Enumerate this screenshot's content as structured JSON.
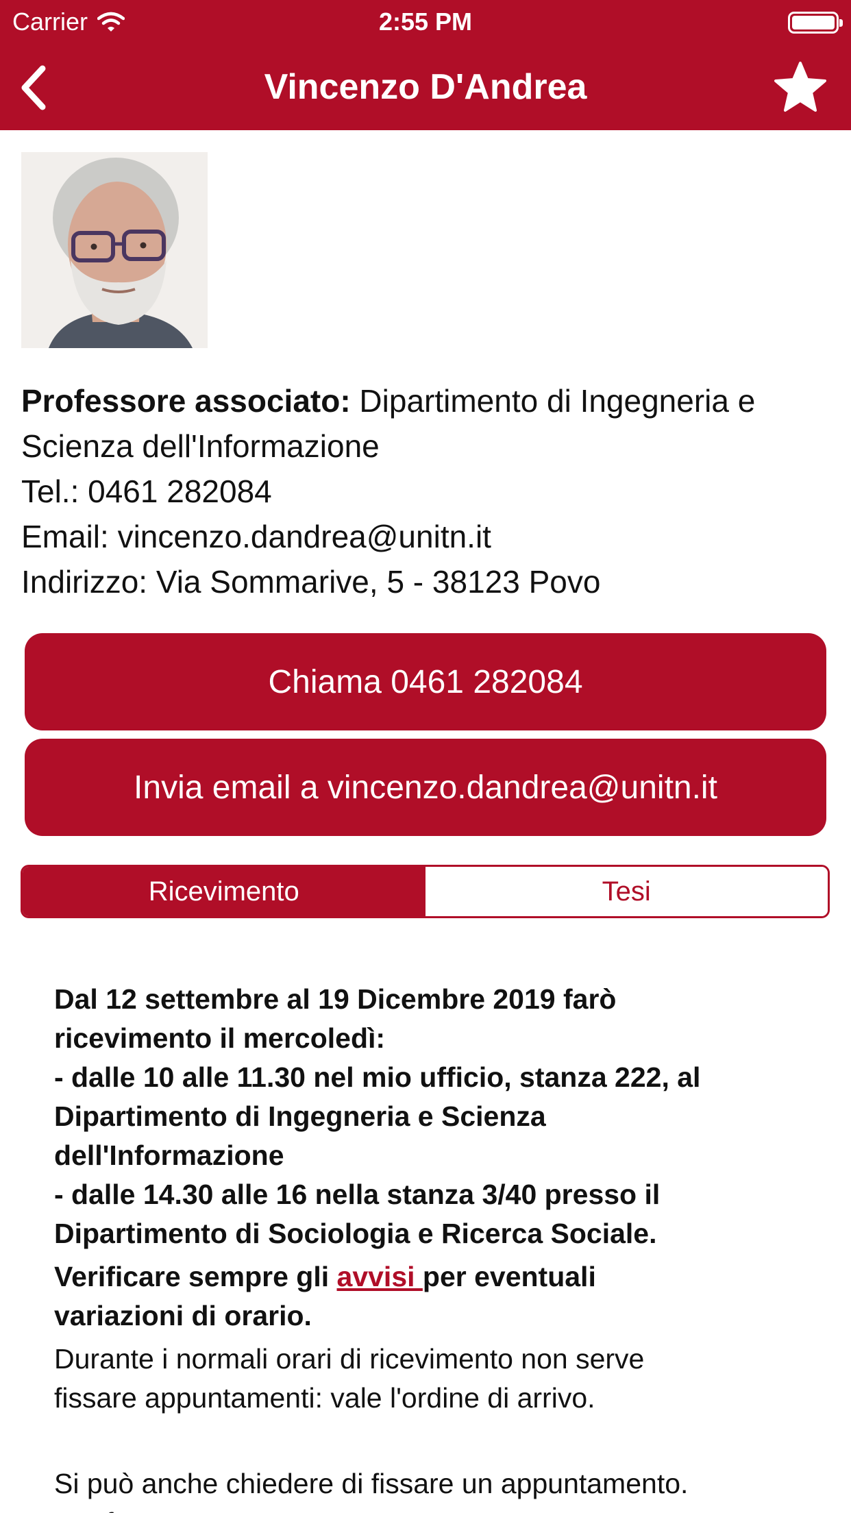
{
  "status_bar": {
    "carrier": "Carrier",
    "time": "2:55 PM"
  },
  "nav": {
    "title": "Vincenzo D'Andrea",
    "back_icon": "chevron-left-icon",
    "favorite_icon": "star-icon"
  },
  "profile": {
    "role_label": "Professore associato:",
    "department": " Dipartimento di Ingegneria e Scienza dell'Informazione",
    "phone_line": "Tel.: 0461 282084",
    "email_line": "Email: vincenzo.dandrea@unitn.it",
    "address_line": "Indirizzo: Via Sommarive, 5 - 38123 Povo"
  },
  "actions": {
    "call_label": "Chiama 0461 282084",
    "email_label": "Invia email a vincenzo.dandrea@unitn.it"
  },
  "tabs": [
    {
      "label": "Ricevimento",
      "selected": true
    },
    {
      "label": "Tesi",
      "selected": false
    }
  ],
  "reception": {
    "bold_lines": [
      "Dal 12 settembre al 19 Dicembre 2019 farò",
      "ricevimento il mercoledì:",
      "- dalle 10 alle 11.30 nel mio ufficio, stanza 222, al",
      "Dipartimento di Ingegneria e Scienza",
      "dell'Informazione",
      "- dalle 14.30 alle 16 nella stanza 3/40 presso il",
      "Dipartimento di Sociologia e Ricerca Sociale."
    ],
    "notice_prefix": "Verificare sempre gli ",
    "notice_link": "avvisi ",
    "notice_suffix": "per eventuali",
    "notice_line2": "variazioni di orario.",
    "plain_lines": [
      "Durante i normali orari di ricevimento non serve",
      "fissare appuntamenti: vale l'ordine di arrivo."
    ],
    "extra_line": "Si può anche chiedere di fissare un appuntamento.",
    "cut_line": "Per far"
  },
  "colors": {
    "brand": "#B00E28",
    "text": "#111111",
    "background": "#FFFFFF"
  }
}
